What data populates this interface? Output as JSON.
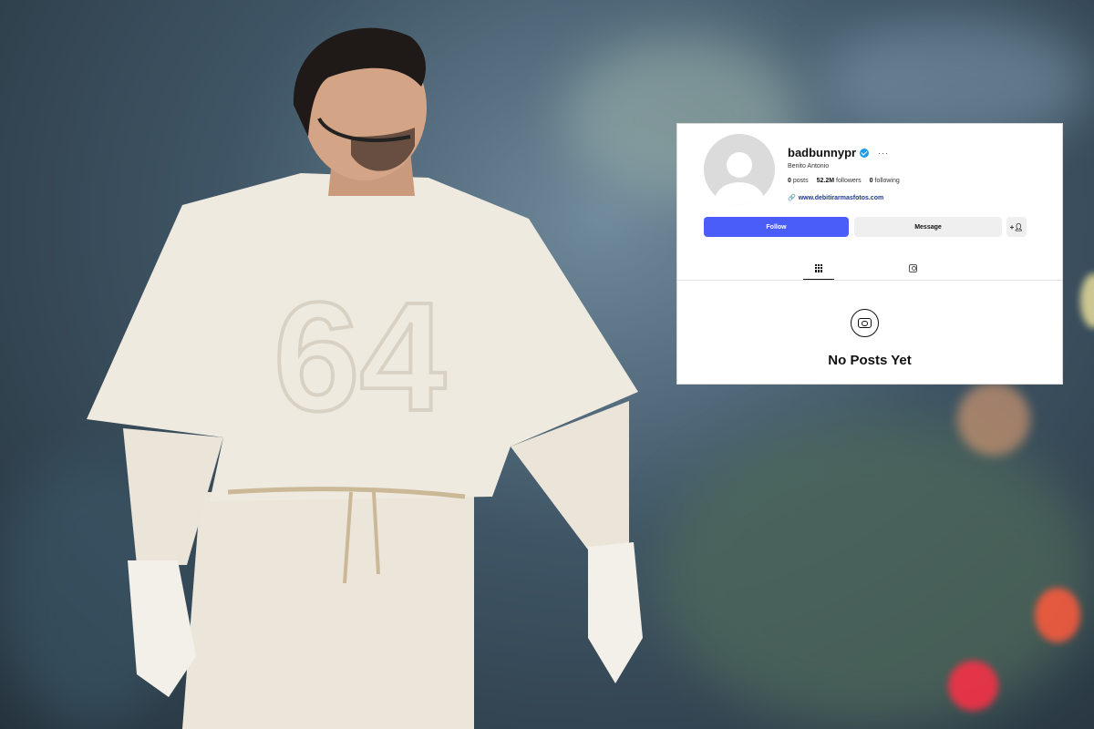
{
  "profile": {
    "username": "badbunnypr",
    "more_label": "···",
    "display_name": "Benito Antonio",
    "stats": {
      "posts_count": "0",
      "posts_label": "posts",
      "followers_count": "52.2M",
      "followers_label": "followers",
      "following_count": "0",
      "following_label": "following"
    },
    "link": "www.debitirarmasfotos.com"
  },
  "actions": {
    "follow_label": "Follow",
    "message_label": "Message",
    "add_user_icon": "add-user-icon"
  },
  "tabs": [
    {
      "icon": "grid-icon",
      "active": true
    },
    {
      "icon": "tagged-icon",
      "active": false
    }
  ],
  "empty_state": {
    "icon": "camera-icon",
    "text": "No Posts Yet"
  },
  "colors": {
    "follow_button": "#4a5df9",
    "verified_badge": "#1d9bf0",
    "link_text": "#1f3a8a"
  }
}
